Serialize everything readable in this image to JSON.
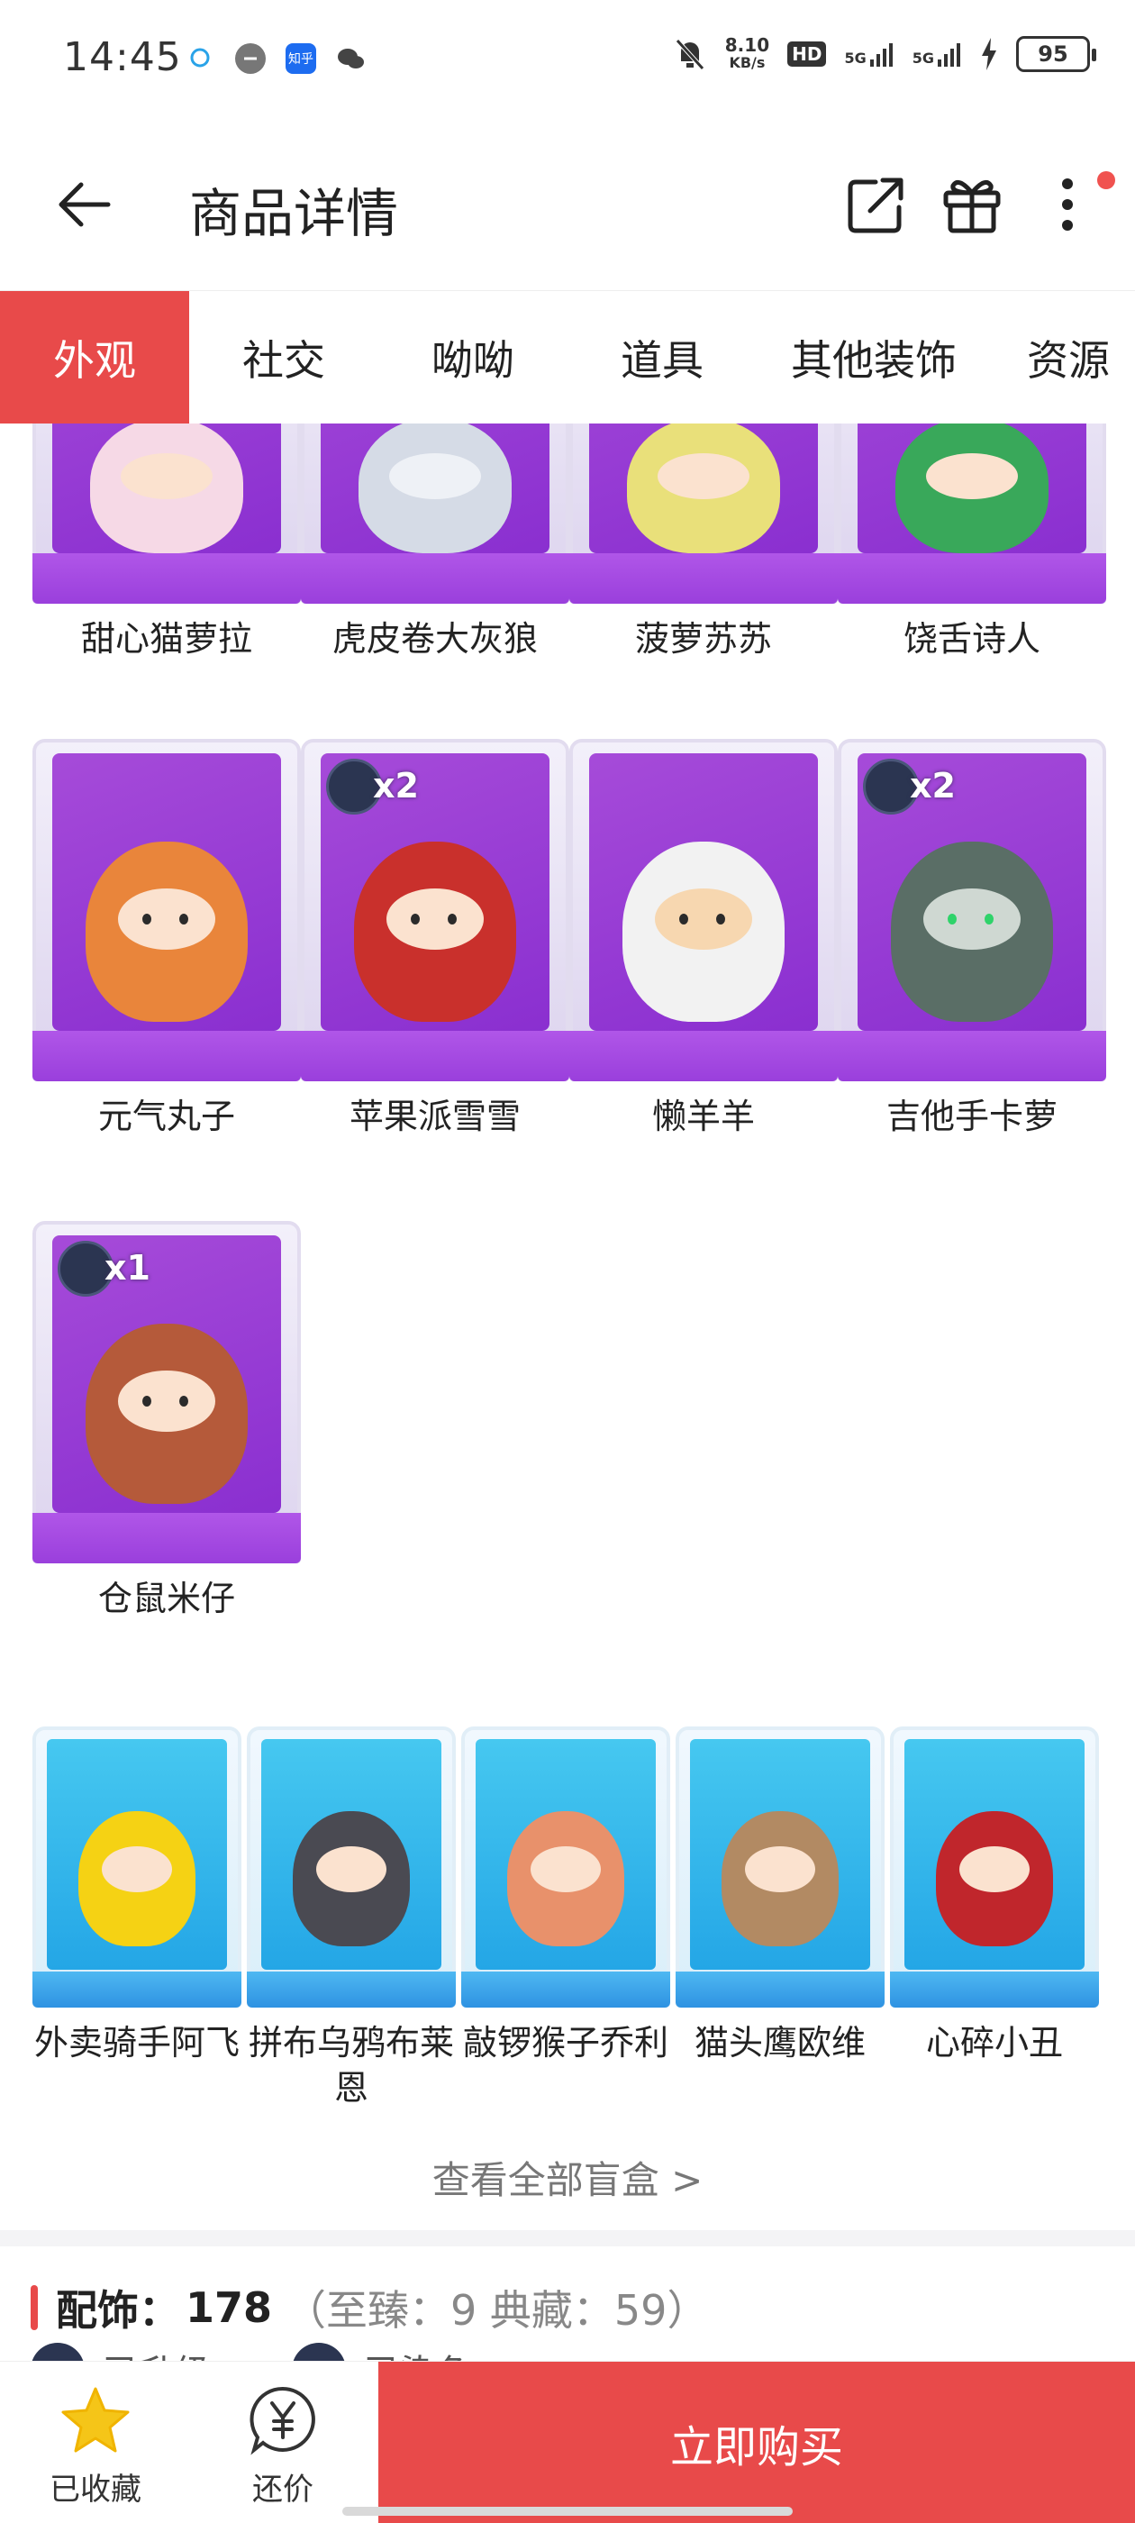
{
  "status_bar": {
    "time": "14:45",
    "net_speed_value": "8.10",
    "net_speed_unit": "KB/s",
    "hd_label": "HD",
    "network_1": "5G",
    "network_2": "5G",
    "battery": "95",
    "app_icons": [
      "qq-icon",
      "app-icon",
      "zhihu-icon",
      "wechat-icon"
    ],
    "zhihu_label": "知乎"
  },
  "header": {
    "title": "商品详情",
    "icons": [
      "back-arrow-icon",
      "share-icon",
      "gift-icon",
      "more-icon"
    ]
  },
  "tabs": [
    {
      "label": "外观",
      "active": true
    },
    {
      "label": "社交",
      "active": false
    },
    {
      "label": "呦呦",
      "active": false
    },
    {
      "label": "道具",
      "active": false
    },
    {
      "label": "其他装饰",
      "active": false
    },
    {
      "label": "资源",
      "active": false
    }
  ],
  "purple_items": [
    {
      "name": "甜心猫萝拉",
      "badge": ""
    },
    {
      "name": "虎皮卷大灰狼",
      "badge": ""
    },
    {
      "name": "菠萝苏苏",
      "badge": ""
    },
    {
      "name": "饶舌诗人",
      "badge": ""
    },
    {
      "name": "元气丸子",
      "badge": ""
    },
    {
      "name": "苹果派雪雪",
      "badge": "x2"
    },
    {
      "name": "懒羊羊",
      "badge": ""
    },
    {
      "name": "吉他手卡萝",
      "badge": "x2"
    },
    {
      "name": "仓鼠米仔",
      "badge": "x1"
    }
  ],
  "blue_items": [
    {
      "name": "外卖骑手阿飞"
    },
    {
      "name": "拼布乌鸦布莱恩"
    },
    {
      "name": "敲锣猴子乔利"
    },
    {
      "name": "猫头鹰欧维"
    },
    {
      "name": "心碎小丑"
    }
  ],
  "view_all": "查看全部盲盒 >",
  "accessory": {
    "label": "配饰：",
    "value": "178",
    "detail": "（至臻：9 典藏：59）"
  },
  "peek": [
    "已升级",
    "已染色"
  ],
  "bottom_bar": {
    "favorite_label": "已收藏",
    "bargain_label": "还价",
    "buy_label": "立即购买"
  },
  "colors": {
    "accent_red": "#e84a4a",
    "purple_box": "#9a3fdc",
    "blue_box": "#2ea6e6",
    "star_yellow": "#f5c518"
  }
}
